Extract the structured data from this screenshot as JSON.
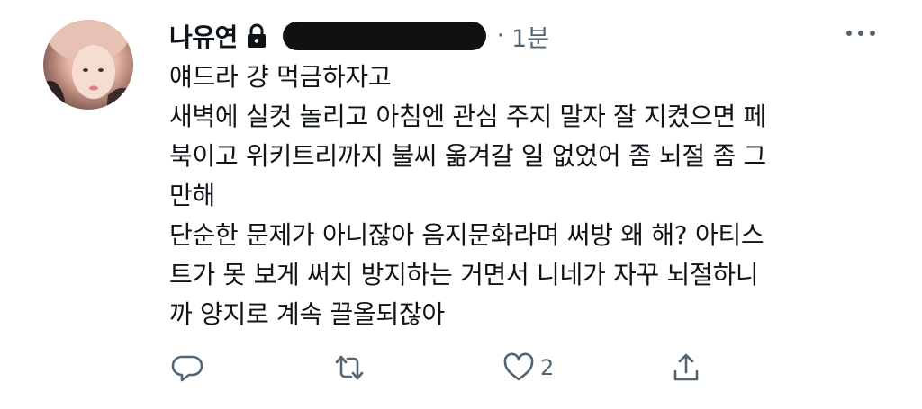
{
  "tweet": {
    "display_name": "나유연",
    "timestamp": "1분",
    "separator": "·",
    "body_lines": [
      "얘드라 걍 먹금하자고",
      "새벽에 실컷 놀리고 아침엔 관심 주지 말자 잘 지켰으면 페",
      "북이고 위키트리까지 불씨 옮겨갈 일 없었어 좀 뇌절 좀 그",
      "만해",
      "단순한 문제가 아니잖아 음지문화라며 써방 왜 해? 아티스",
      "트가 못 보게 써치 방지하는 거면서 니네가 자꾸 뇌절하니",
      "까 양지로 계속 끌올되잖아"
    ],
    "like_count": "2"
  },
  "icons": {
    "lock": "lock-icon",
    "more": "more-horizontal-icon",
    "reply": "reply-icon",
    "retweet": "retweet-icon",
    "like": "heart-icon",
    "share": "share-icon"
  },
  "colors": {
    "text": "#0f1419",
    "secondary": "#536471",
    "redaction": "#111111"
  }
}
